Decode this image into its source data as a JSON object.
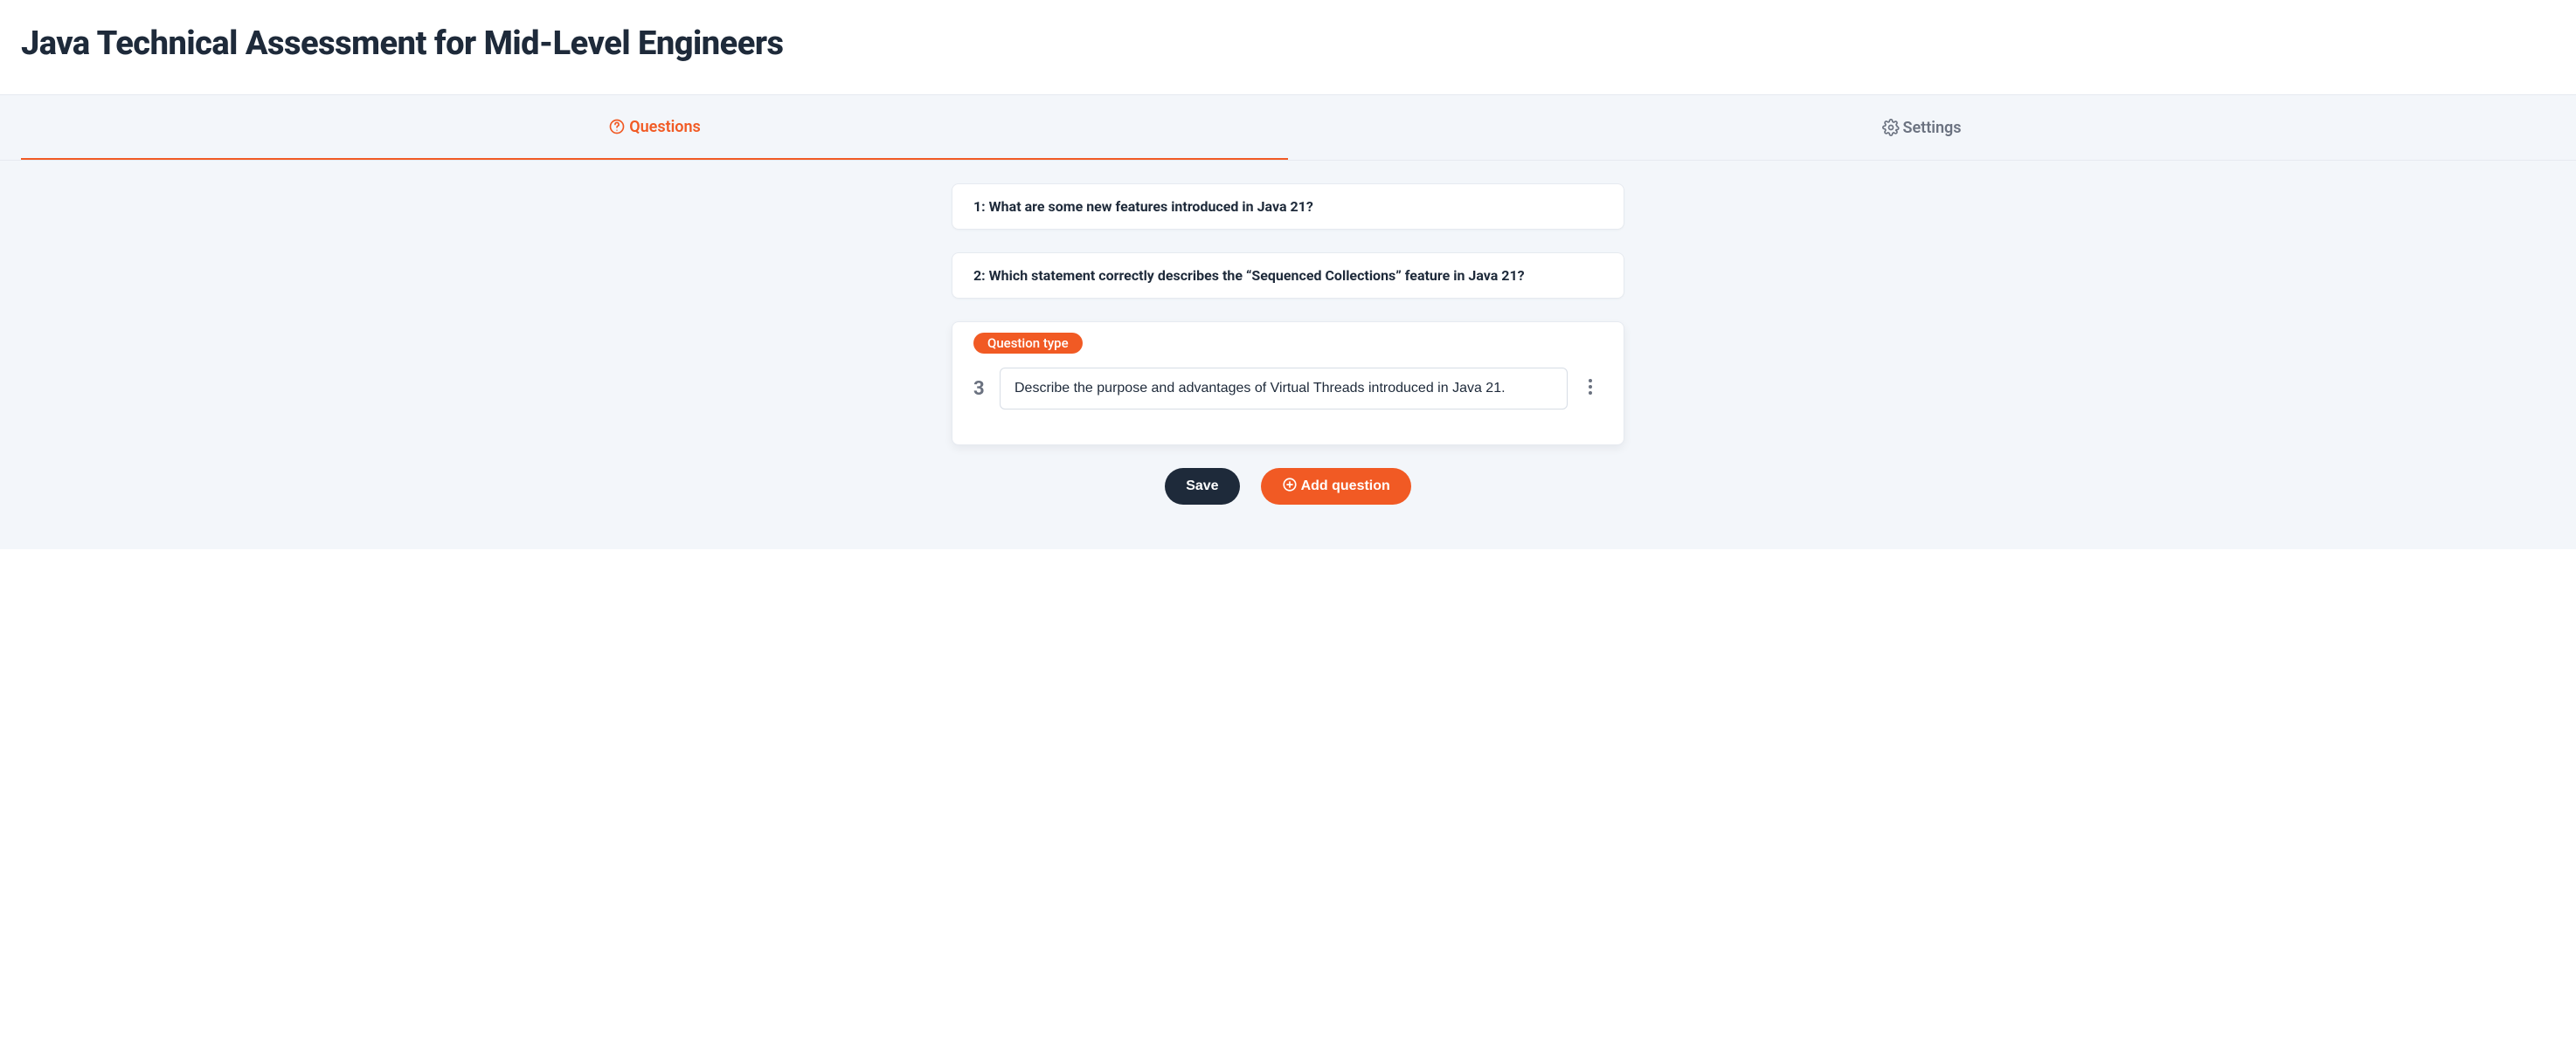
{
  "header": {
    "title": "Java Technical Assessment for Mid-Level Engineers"
  },
  "tabs": {
    "questions_label": "Questions",
    "settings_label": "Settings"
  },
  "questions": [
    {
      "summary": "1: What are some new features introduced in Java 21?"
    },
    {
      "summary": "2: Which statement correctly describes the “Sequenced Collections” feature in Java 21?"
    }
  ],
  "editing": {
    "pill_label": "Question type",
    "number": "3",
    "text": "Describe the purpose and advantages of Virtual Threads introduced in Java 21."
  },
  "actions": {
    "save_label": "Save",
    "add_label": "Add question"
  }
}
